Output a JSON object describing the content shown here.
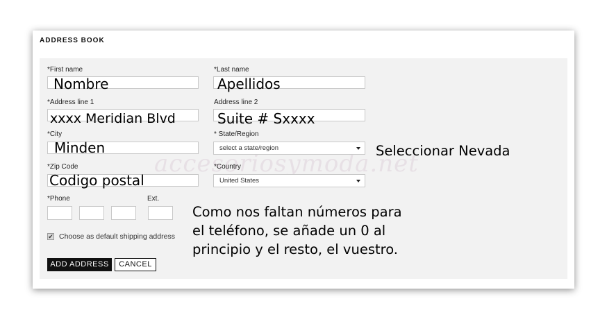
{
  "card": {
    "title": "ADDRESS BOOK"
  },
  "form": {
    "first_name_label": "*First name",
    "first_name_value": "Nombre",
    "last_name_label": "*Last name",
    "last_name_value": "Apellidos",
    "address1_label": "*Address line 1",
    "address1_value": "xxxx Meridian Blvd",
    "address2_label": "Address line 2",
    "address2_value": "Suite # Sxxxx",
    "city_label": "*City",
    "city_value": "Minden",
    "state_label": "* State/Region",
    "state_selected": "select a state/region",
    "zip_label": "*Zip Code",
    "zip_value": "Codigo postal",
    "country_label": "*Country",
    "country_selected": "United States",
    "phone_label": "*Phone",
    "ext_label": "Ext.",
    "default_shipping_label": "Choose as default shipping address",
    "default_shipping_checked": true,
    "add_button": "ADD ADDRESS",
    "cancel_button": "CANCEL"
  },
  "annotations": {
    "state_note": "Seleccionar Nevada",
    "phone_note_line1": "Como nos faltan números para",
    "phone_note_line2": "el teléfono, se añade un 0 al",
    "phone_note_line3": "principio y el resto, el vuestro.",
    "watermark": "accesoriosymoda.net"
  }
}
